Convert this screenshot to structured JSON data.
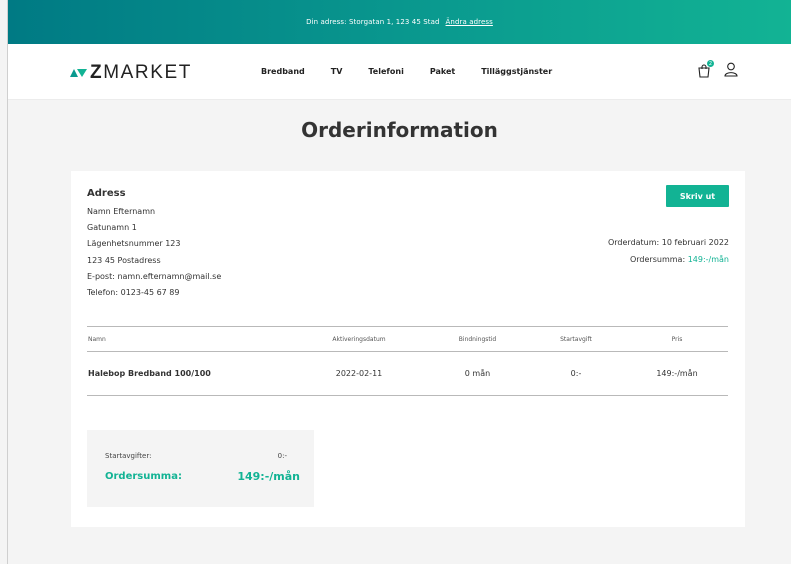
{
  "topbar": {
    "address_text": "Din adress: Storgatan 1, 123 45 Stad",
    "change_link": "Ändra adress"
  },
  "brand": {
    "logo_z": "Z",
    "logo_rest": "MARKET"
  },
  "nav": {
    "items": [
      "Bredband",
      "TV",
      "Telefoni",
      "Paket",
      "Tilläggstjänster"
    ],
    "cart_badge": "2"
  },
  "page": {
    "title": "Orderinformation"
  },
  "address": {
    "heading": "Adress",
    "name": "Namn Efternamn",
    "street": "Gatunamn 1",
    "apartment": "Lägenhetsnummer 123",
    "postal": "123 45 Postadress",
    "email": "E-post: namn.efternamn@mail.se",
    "phone": "Telefon: 0123-45 67 89"
  },
  "actions": {
    "print_label": "Skriv ut"
  },
  "order": {
    "date_text": "Orderdatum: 10 februari 2022",
    "sum_label": "Ordersumma:",
    "sum_value": "149:-/mån"
  },
  "table": {
    "headers": [
      "Namn",
      "Aktiveringsdatum",
      "Bindningstid",
      "Startavgift",
      "Pris"
    ],
    "rows": [
      [
        "Halebop Bredband 100/100",
        "2022-02-11",
        "0 mån",
        "0:-",
        "149:-/mån"
      ]
    ]
  },
  "summary": {
    "start_fee_label": "Startavgifter:",
    "start_fee_value": "0:-",
    "total_label": "Ordersumma:",
    "total_value": "149:-/mån"
  },
  "colors": {
    "accent": "#12b394",
    "topbar_start": "#007a84"
  },
  "icons": {
    "logo_mark": "zmarket-chevron-logo",
    "cart": "shopping-bag-icon",
    "user": "user-icon"
  }
}
